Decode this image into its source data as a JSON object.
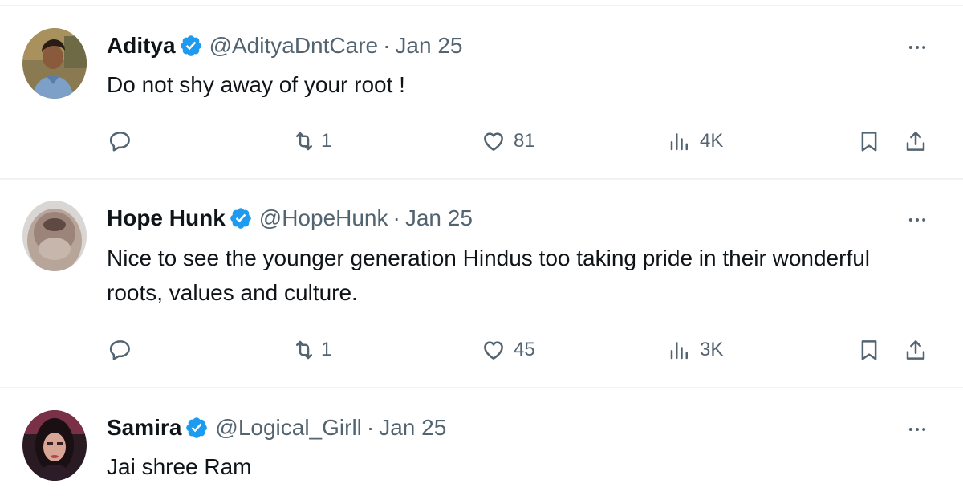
{
  "tweets": [
    {
      "name": "Aditya",
      "handle": "@AdityaDntCare",
      "separator": "·",
      "date": "Jan 25",
      "text": "Do not shy away of your root !",
      "replies": "",
      "reposts": "1",
      "likes": "81",
      "views": "4K",
      "avatar_icon": "avatar-photo"
    },
    {
      "name": "Hope Hunk",
      "handle": "@HopeHunk",
      "separator": "·",
      "date": "Jan 25",
      "text": "Nice to see the younger generation Hindus too taking pride in their wonderful roots, values and culture.",
      "replies": "",
      "reposts": "1",
      "likes": "45",
      "views": "3K",
      "avatar_icon": "avatar-photo"
    },
    {
      "name": "Samira",
      "handle": "@Logical_Girll",
      "separator": "·",
      "date": "Jan 25",
      "text": "Jai shree Ram",
      "avatar_icon": "avatar-photo"
    }
  ],
  "colors": {
    "verified_badge": "#1d9bf0",
    "secondary_text": "#536471",
    "primary_text": "#0f1419",
    "divider": "#eff3f4"
  },
  "icons": [
    "verified-badge-icon",
    "more-icon",
    "reply-icon",
    "repost-icon",
    "like-icon",
    "views-icon",
    "bookmark-icon",
    "share-icon"
  ]
}
